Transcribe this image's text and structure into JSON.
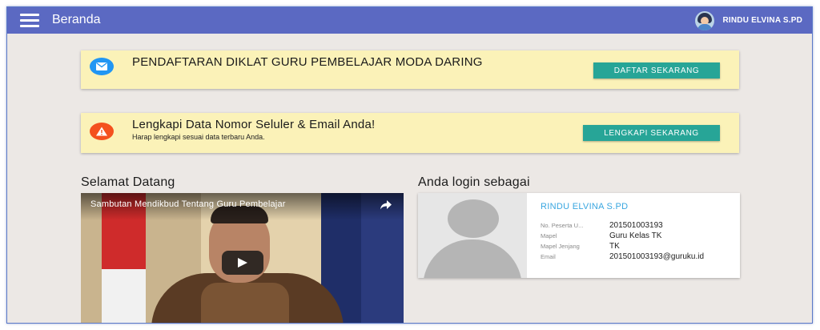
{
  "appbar": {
    "title": "Beranda",
    "user_name": "RINDU ELVINA S.PD"
  },
  "banners": [
    {
      "icon": "mail-icon",
      "icon_color": "#2196f3",
      "title": "PENDAFTARAN DIKLAT GURU PEMBELAJAR MODA DARING",
      "subtitle": "",
      "button_label": "DAFTAR SEKARANG"
    },
    {
      "icon": "warning-icon",
      "icon_color": "#f4511e",
      "title": "Lengkapi Data Nomor Seluler & Email Anda!",
      "subtitle": "Harap lengkapi sesuai data terbaru Anda.",
      "button_label": "LENGKAPI SEKARANG"
    }
  ],
  "welcome": {
    "title": "Selamat Datang",
    "video_title": "Sambutan Mendikbud Tentang Guru Pembelajar"
  },
  "login": {
    "title": "Anda login sebagai",
    "name": "RINDU ELVINA S.PD",
    "fields": [
      {
        "label": "No. Peserta U...",
        "value": "201501003193"
      },
      {
        "label": "Mapel",
        "value": "Guru Kelas TK"
      },
      {
        "label": "Mapel Jenjang",
        "value": "TK"
      },
      {
        "label": "Email",
        "value": "201501003193@guruku.id"
      }
    ]
  },
  "colors": {
    "appbar": "#5b69c2",
    "banner_bg": "#fbf2b8",
    "button": "#27a597",
    "link_blue": "#39a6e0",
    "page_bg": "#ece8e5"
  }
}
